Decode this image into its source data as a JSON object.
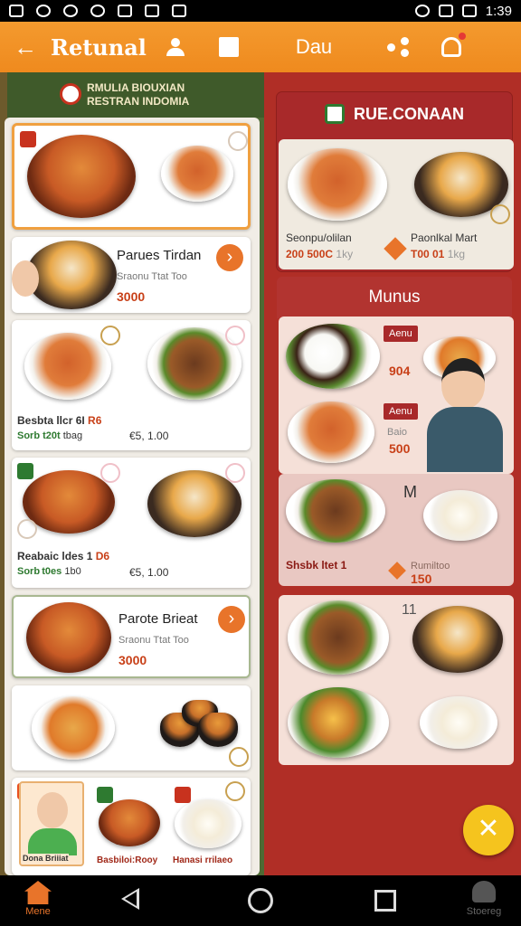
{
  "status_bar": {
    "time": "1:39"
  },
  "app_bar": {
    "title": "Retunal",
    "title2": "Dau"
  },
  "left": {
    "restaurant": {
      "line1": "RMULIA BIOUXIAN",
      "line2": "RESTRAN INDOMIA"
    },
    "items": [
      {
        "name": "Parues Tirdan",
        "sub": "Sraonu Ttat Too",
        "price": "3000"
      },
      {
        "left_name": "Besbta llcr 6I",
        "left_tag": "R6",
        "left_price": "Sorb t20t",
        "left_unit": "tbag",
        "right_price": "€5, 1.00"
      },
      {
        "left_name": "Reabaic ldes 1",
        "left_tag": "D6",
        "left_price": "Sorb t0es",
        "left_unit": "1b0",
        "right_price": "€5, 1.00"
      },
      {
        "name": "Parote Brieat",
        "sub": "Sraonu Ttat Too",
        "price": "3000"
      },
      {
        "caption1": "Dona Briiiat",
        "caption2": "Basbiloi:Rooу",
        "caption3": "Hanasi rrilaeo"
      }
    ]
  },
  "right": {
    "rec_title": "RUE.CONAAN",
    "rec_items": [
      {
        "name": "Seonpu/olilan",
        "price": "200  500C",
        "unit": "1ky"
      },
      {
        "name": "Paonlkal Mart",
        "price": "T00 01",
        "unit": "1kg"
      }
    ],
    "menus_title": "Munus",
    "tag1": "Aenu",
    "price1": "904",
    "tag2": "Aenu",
    "sub2": "Baio",
    "price2": "500",
    "mark3": "M",
    "name3": "Shsbk ltet 1",
    "sub3": "Rumiltoo",
    "price3": "150",
    "mark4": "11"
  },
  "nav": {
    "home": "Mene",
    "store": "Stoereg"
  },
  "colors": {
    "accent": "#ef8a1e",
    "left_bg": "#4e6a34",
    "right_bg": "#b02e26",
    "fab": "#f5c41e"
  },
  "icons": [
    "back-arrow-icon",
    "person-icon",
    "book-icon",
    "share-icon",
    "notification-icon",
    "close-icon",
    "home-icon",
    "store-icon"
  ]
}
